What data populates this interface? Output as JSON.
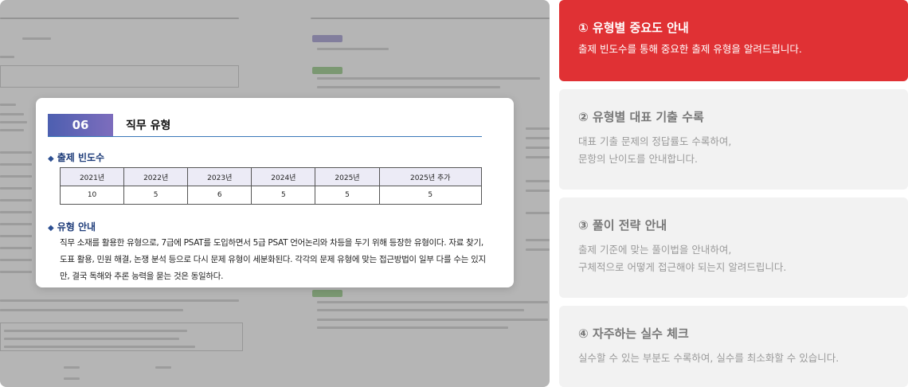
{
  "preview": {
    "section_number": "06",
    "section_title": "직무 유형",
    "frequency_heading": "출제 빈도수",
    "frequency_table": {
      "headers": [
        "2021년",
        "2022년",
        "2023년",
        "2024년",
        "2025년",
        "2025년 추가"
      ],
      "values": [
        "10",
        "5",
        "6",
        "5",
        "5",
        "5"
      ]
    },
    "guide_heading": "유형 안내",
    "guide_text": "직무 소재를 활용한 유형으로, 7급에 PSAT를 도입하면서 5급 PSAT 언어논리와 차등을 두기 위해 등장한 유형이다. 자료 찾기, 도표 활용, 민원 해결, 논쟁 분석 등으로 다시 문제 유형이 세분화된다. 각각의 문제 유형에 맞는 접근방법이 일부 다를 수는 있지만, 결국 독해와 추론 능력을 묻는 것은 동일하다.",
    "diamond_glyph": "◆"
  },
  "features": [
    {
      "title": "① 유형별 중요도 안내",
      "desc_lines": [
        "출제 빈도수를 통해 중요한 출제 유형을 알려드립니다."
      ]
    },
    {
      "title": "② 유형별 대표 기출 수록",
      "desc_lines": [
        "대표 기출 문제의 정답률도 수록하여,",
        "문항의 난이도를 안내합니다."
      ]
    },
    {
      "title": "③ 풀이 전략 안내",
      "desc_lines": [
        "출제 기준에 맞는 풀이법을 안내하여,",
        "구체적으로 어떻게 접근해야 되는지 알려드립니다."
      ]
    },
    {
      "title": "④ 자주하는 실수 체크",
      "desc_lines": [
        "실수할 수 있는 부분도 수록하여, 실수를 최소화할 수 있습니다."
      ]
    }
  ],
  "colors": {
    "active": "#e03134",
    "inactive": "#f2f2f2",
    "section_gradient_start": "#4d5fb0",
    "section_gradient_end": "#7d6dbd"
  }
}
